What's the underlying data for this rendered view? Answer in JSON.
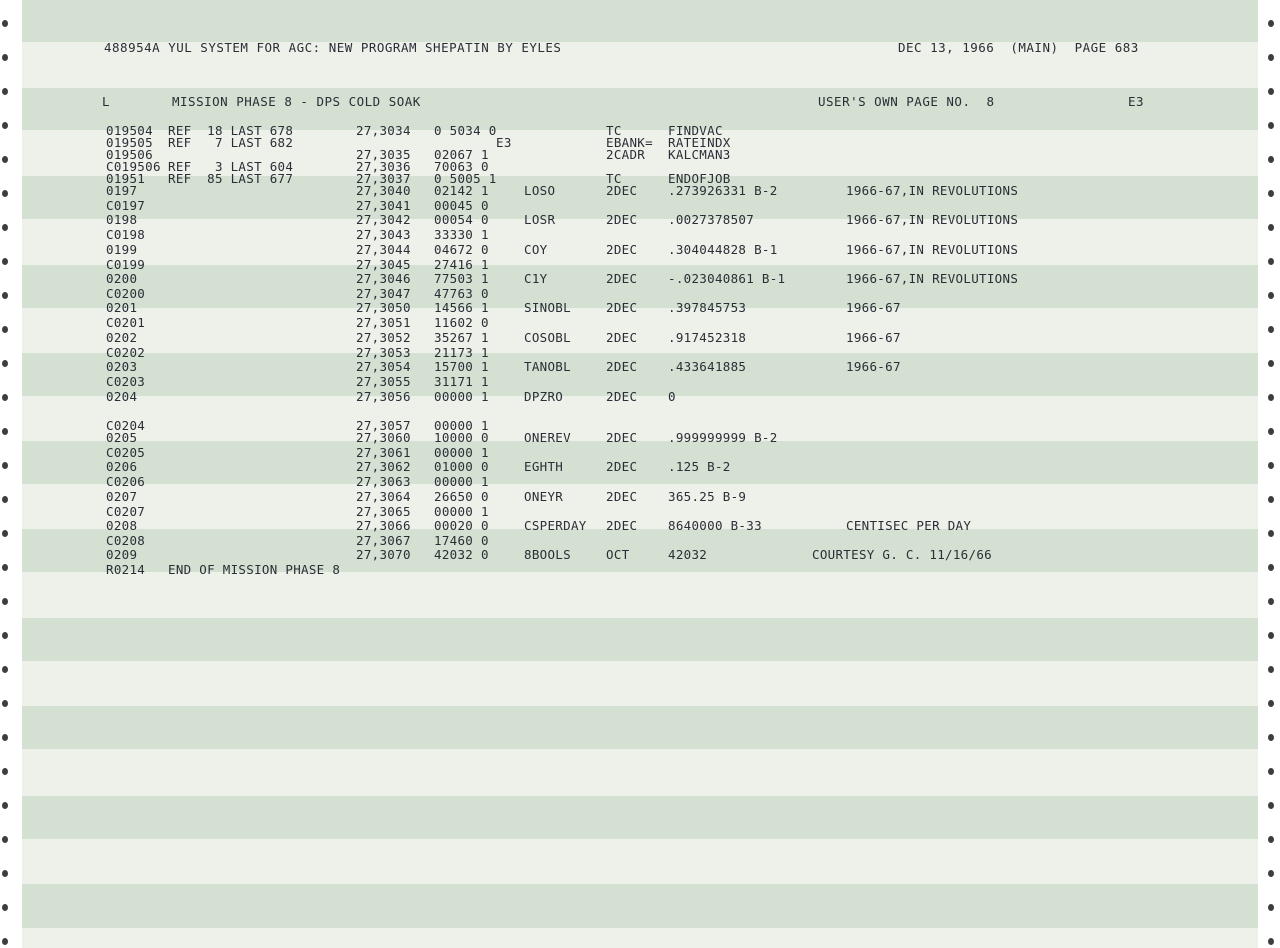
{
  "header": {
    "left": "488954A YUL SYSTEM FOR AGC: NEW PROGRAM SHEPATIN BY EYLES",
    "right": "DEC 13, 1966  (MAIN)  PAGE 683"
  },
  "subheader": {
    "type": "L",
    "title": "MISSION PHASE 8 - DPS COLD SOAK",
    "user_page": "USER'S OWN PAGE NO.  8",
    "bank": "E3"
  },
  "rows": [
    {
      "loc": "019504",
      "ref": "REF  18 LAST 678",
      "addr": "27,3034",
      "octal": "0 5034 0",
      "label": "",
      "op": "TC",
      "operand": "FINDVAC",
      "comment": ""
    },
    {
      "loc": "019505",
      "ref": "REF   7 LAST 682",
      "addr": "",
      "octal": "E3",
      "label": "",
      "op": "EBANK=",
      "operand": "RATEINDX",
      "comment": ""
    },
    {
      "loc": "019506",
      "ref": "",
      "addr": "27,3035",
      "octal": "02067 1",
      "label": "",
      "op": "2CADR",
      "operand": "KALCMAN3",
      "comment": ""
    },
    {
      "loc": "C019506",
      "ref": "REF   3 LAST 604",
      "addr": "27,3036",
      "octal": "70063 0",
      "label": "",
      "op": "",
      "operand": "",
      "comment": ""
    },
    {
      "loc": "01951",
      "ref": "REF  85 LAST 677",
      "addr": "27,3037",
      "octal": "0 5005 1",
      "label": "",
      "op": "TC",
      "operand": "ENDOFJOB",
      "comment": ""
    },
    {
      "loc": "0197",
      "ref": "",
      "addr": "27,3040",
      "octal": "02142 1",
      "label": "LOSO",
      "op": "2DEC",
      "operand": ".273926331 B-2",
      "comment": "1966-67,IN REVOLUTIONS"
    },
    {
      "loc": "C0197",
      "ref": "",
      "addr": "27,3041",
      "octal": "00045 0",
      "label": "",
      "op": "",
      "operand": "",
      "comment": ""
    },
    {
      "loc": "0198",
      "ref": "",
      "addr": "27,3042",
      "octal": "00054 0",
      "label": "LOSR",
      "op": "2DEC",
      "operand": ".0027378507",
      "comment": "1966-67,IN REVOLUTIONS"
    },
    {
      "loc": "C0198",
      "ref": "",
      "addr": "27,3043",
      "octal": "33330 1",
      "label": "",
      "op": "",
      "operand": "",
      "comment": ""
    },
    {
      "loc": "0199",
      "ref": "",
      "addr": "27,3044",
      "octal": "04672 0",
      "label": "COY",
      "op": "2DEC",
      "operand": ".304044828 B-1",
      "comment": "1966-67,IN REVOLUTIONS"
    },
    {
      "loc": "C0199",
      "ref": "",
      "addr": "27,3045",
      "octal": "27416 1",
      "label": "",
      "op": "",
      "operand": "",
      "comment": ""
    },
    {
      "loc": "0200",
      "ref": "",
      "addr": "27,3046",
      "octal": "77503 1",
      "label": "C1Y",
      "op": "2DEC",
      "operand": "-.023040861 B-1",
      "comment": "1966-67,IN REVOLUTIONS"
    },
    {
      "loc": "C0200",
      "ref": "",
      "addr": "27,3047",
      "octal": "47763 0",
      "label": "",
      "op": "",
      "operand": "",
      "comment": ""
    },
    {
      "loc": "0201",
      "ref": "",
      "addr": "27,3050",
      "octal": "14566 1",
      "label": "SINOBL",
      "op": "2DEC",
      "operand": ".397845753",
      "comment": "1966-67"
    },
    {
      "loc": "C0201",
      "ref": "",
      "addr": "27,3051",
      "octal": "11602 0",
      "label": "",
      "op": "",
      "operand": "",
      "comment": ""
    },
    {
      "loc": "0202",
      "ref": "",
      "addr": "27,3052",
      "octal": "35267 1",
      "label": "COSOBL",
      "op": "2DEC",
      "operand": ".917452318",
      "comment": "1966-67"
    },
    {
      "loc": "C0202",
      "ref": "",
      "addr": "27,3053",
      "octal": "21173 1",
      "label": "",
      "op": "",
      "operand": "",
      "comment": ""
    },
    {
      "loc": "0203",
      "ref": "",
      "addr": "27,3054",
      "octal": "15700 1",
      "label": "TANOBL",
      "op": "2DEC",
      "operand": ".433641885",
      "comment": "1966-67"
    },
    {
      "loc": "C0203",
      "ref": "",
      "addr": "27,3055",
      "octal": "31171 1",
      "label": "",
      "op": "",
      "operand": "",
      "comment": ""
    },
    {
      "loc": "0204",
      "ref": "",
      "addr": "27,3056",
      "octal": "00000 1",
      "label": "DPZRO",
      "op": "2DEC",
      "operand": "0",
      "comment": ""
    },
    {
      "loc": "C0204",
      "ref": "",
      "addr": "27,3057",
      "octal": "00000 1",
      "label": "",
      "op": "",
      "operand": "",
      "comment": ""
    },
    {
      "loc": "0205",
      "ref": "",
      "addr": "27,3060",
      "octal": "10000 0",
      "label": "ONEREV",
      "op": "2DEC",
      "operand": ".999999999 B-2",
      "comment": ""
    },
    {
      "loc": "C0205",
      "ref": "",
      "addr": "27,3061",
      "octal": "00000 1",
      "label": "",
      "op": "",
      "operand": "",
      "comment": ""
    },
    {
      "loc": "0206",
      "ref": "",
      "addr": "27,3062",
      "octal": "01000 0",
      "label": "EGHTH",
      "op": "2DEC",
      "operand": ".125 B-2",
      "comment": ""
    },
    {
      "loc": "C0206",
      "ref": "",
      "addr": "27,3063",
      "octal": "00000 1",
      "label": "",
      "op": "",
      "operand": "",
      "comment": ""
    },
    {
      "loc": "0207",
      "ref": "",
      "addr": "27,3064",
      "octal": "26650 0",
      "label": "ONEYR",
      "op": "2DEC",
      "operand": "365.25 B-9",
      "comment": ""
    },
    {
      "loc": "C0207",
      "ref": "",
      "addr": "27,3065",
      "octal": "00000 1",
      "label": "",
      "op": "",
      "operand": "",
      "comment": ""
    },
    {
      "loc": "0208",
      "ref": "",
      "addr": "27,3066",
      "octal": "00020 0",
      "label": "CSPERDAY",
      "op": "2DEC",
      "operand": "8640000 B-33",
      "comment": "CENTISEC PER DAY"
    },
    {
      "loc": "C0208",
      "ref": "",
      "addr": "27,3067",
      "octal": "17460 0",
      "label": "",
      "op": "",
      "operand": "",
      "comment": ""
    },
    {
      "loc": "0209",
      "ref": "",
      "addr": "27,3070",
      "octal": "42032 0",
      "label": "8BOOLS",
      "op": "OCT",
      "operand": "42032",
      "comment": "COURTESY G. C. 11/16/66"
    },
    {
      "loc": "R0214",
      "ref": "END OF MISSION PHASE 8",
      "addr": "",
      "octal": "",
      "label": "",
      "op": "",
      "operand": "",
      "comment": ""
    }
  ]
}
